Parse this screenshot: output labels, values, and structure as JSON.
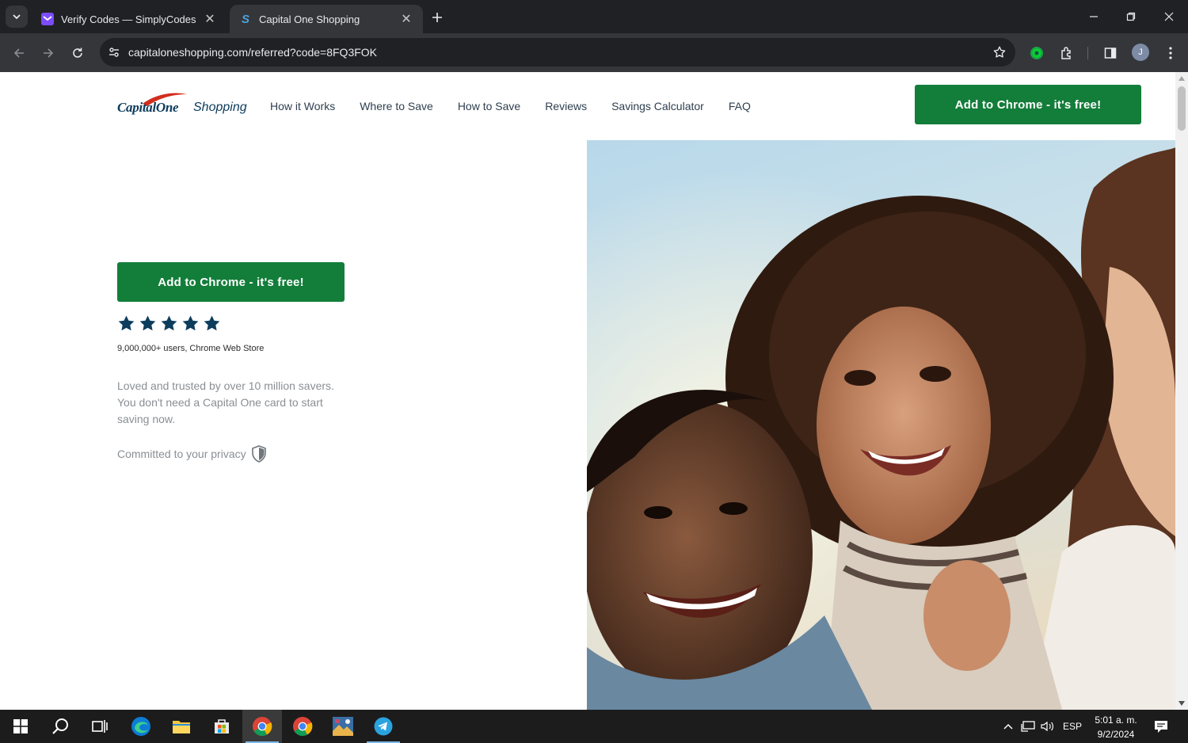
{
  "browser": {
    "tabs": [
      {
        "title": "Verify Codes — SimplyCodes",
        "active": false
      },
      {
        "title": "Capital One Shopping",
        "active": true
      }
    ],
    "close_glyph": "✕",
    "url": "capitaloneshopping.com/referred?code=8FQ3FOK",
    "profile_initial": "J"
  },
  "header": {
    "logo_capital_one": "CapitalOne",
    "logo_shopping": "Shopping",
    "nav": [
      "How it Works",
      "Where to Save",
      "How to Save",
      "Reviews",
      "Savings Calculator",
      "FAQ"
    ],
    "cta": "Add to Chrome - it's free!"
  },
  "hero": {
    "cta": "Add to Chrome - it's free!",
    "rating": 5,
    "users": "9,000,000+ users, Chrome Web Store",
    "description": "Loved and trusted by over 10 million savers. You don't need a Capital One card to start saving now.",
    "privacy": "Committed to your privacy"
  },
  "taskbar": {
    "language": "ESP",
    "time": "5:01 a. m.",
    "date": "9/2/2024"
  },
  "colors": {
    "green": "#137d3a",
    "navy": "#0b3b5c",
    "star": "#0d3d5c"
  },
  "icons": [
    "chevron-down-icon",
    "simplycodes-icon",
    "capitalone-s-icon",
    "plus-icon",
    "minimize-icon",
    "restore-icon",
    "close-icon",
    "back-icon",
    "forward-icon",
    "reload-icon",
    "tune-icon",
    "star-icon",
    "extension-green-icon",
    "puzzle-icon",
    "sidepanel-icon",
    "menu-icon",
    "shield-icon",
    "windows-icon",
    "search-icon",
    "taskview-icon",
    "edge-icon",
    "explorer-icon",
    "store-icon",
    "chrome-icon",
    "photos-icon",
    "telegram-icon",
    "chevron-up-icon",
    "network-icon",
    "volume-icon",
    "notification-icon"
  ]
}
